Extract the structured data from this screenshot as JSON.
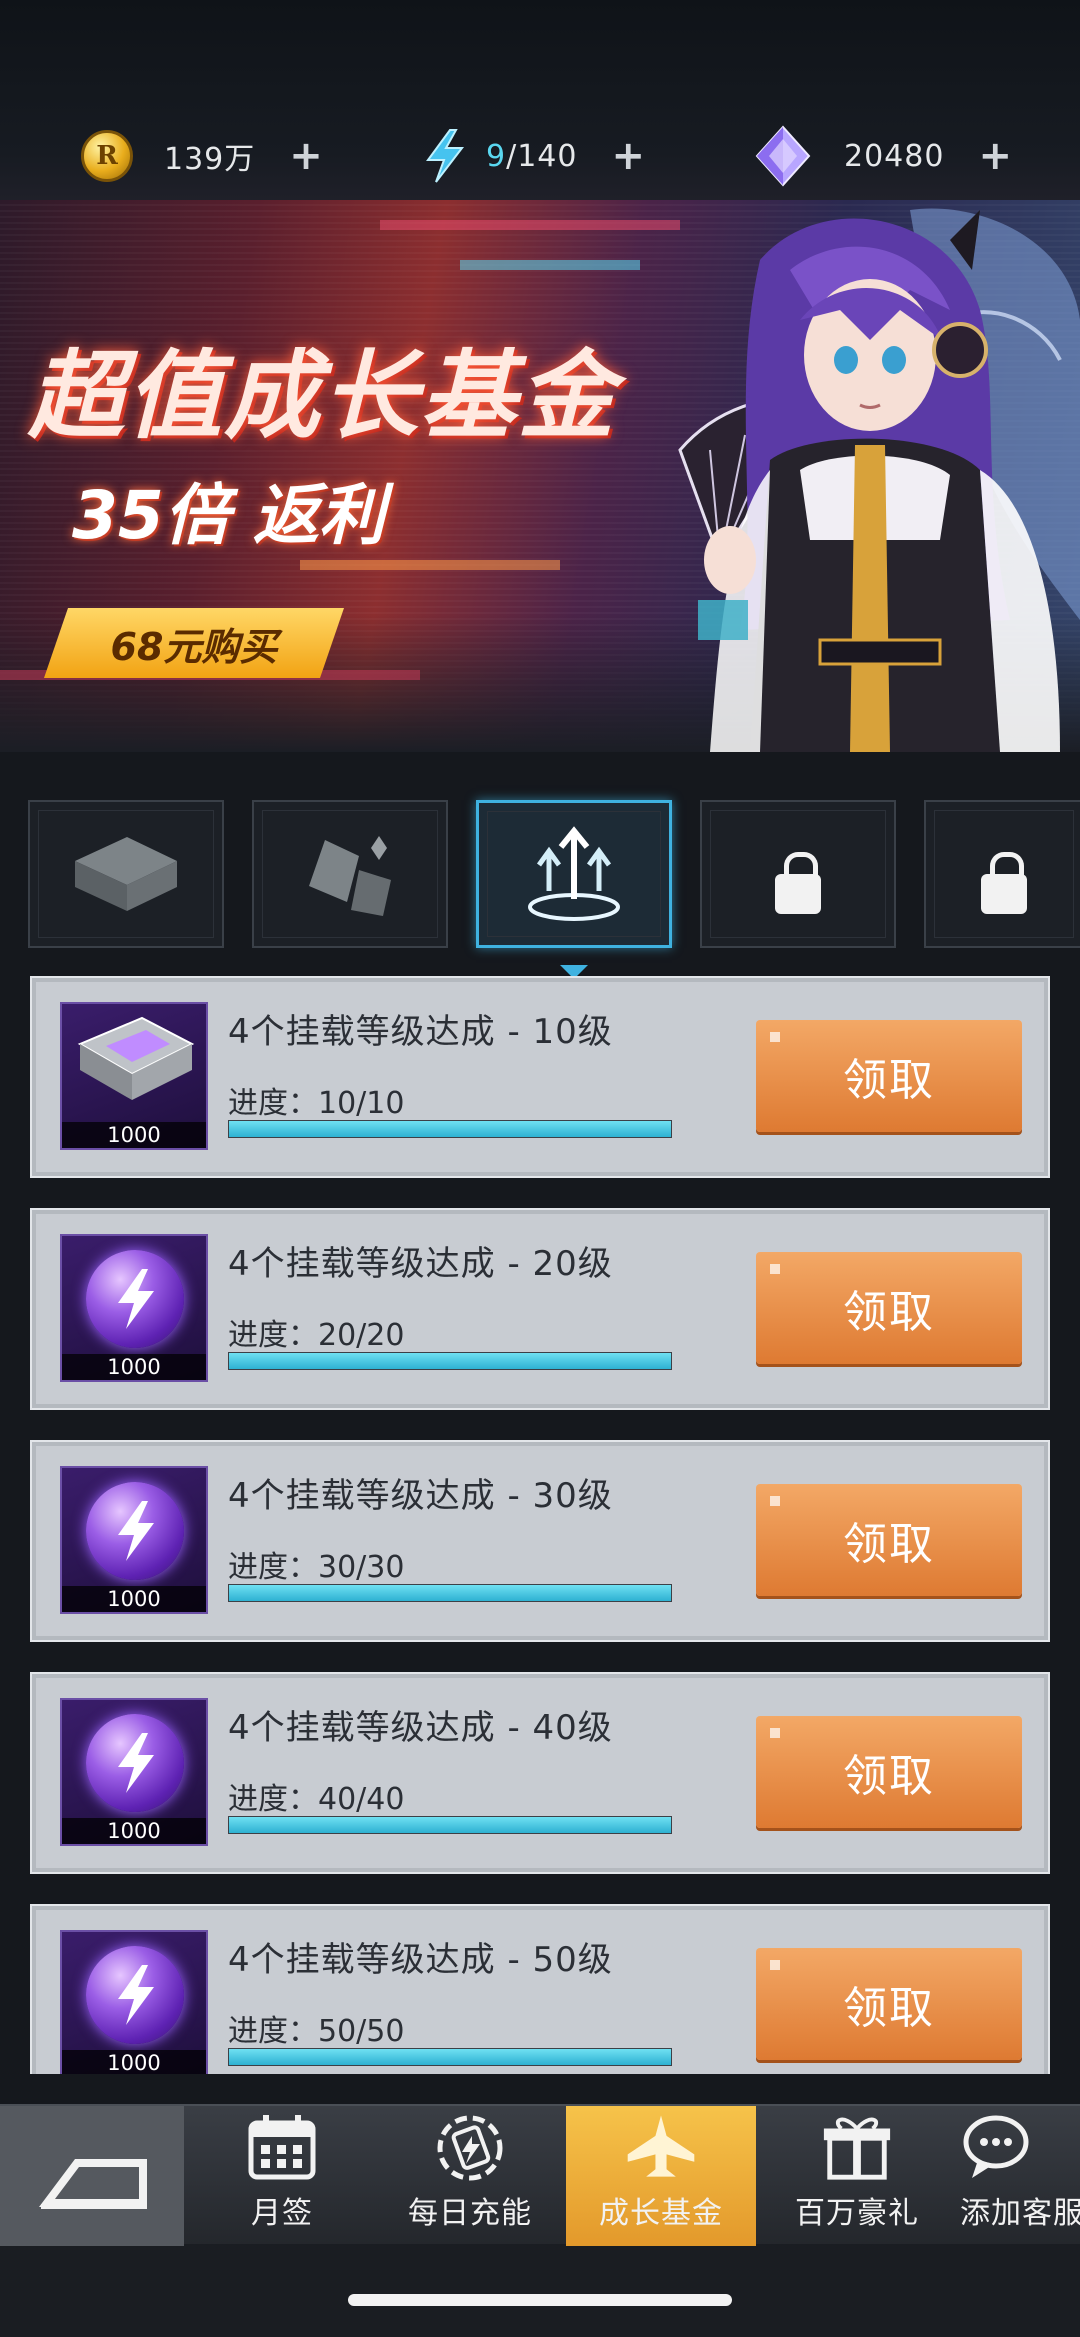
{
  "resources": {
    "coins": {
      "icon": "r-coin-icon",
      "value": "139万"
    },
    "energy": {
      "icon": "lightning-icon",
      "current": "9",
      "max": "/140"
    },
    "crystals": {
      "icon": "crystal-icon",
      "value": "20480"
    },
    "plus": "+"
  },
  "banner": {
    "title": "超值成长基金",
    "subtitle": "35倍 返利",
    "buy_label": "68元购买"
  },
  "tasks": [
    {
      "name": "4个挂载等级达成 - 10级",
      "progress_label": "进度：",
      "progress": "10/10",
      "fraction": 1.0,
      "reward_qty": "1000",
      "reward_icon": "chip-icon",
      "claim_label": "领取"
    },
    {
      "name": "4个挂载等级达成 - 20级",
      "progress_label": "进度：",
      "progress": "20/20",
      "fraction": 1.0,
      "reward_qty": "1000",
      "reward_icon": "energy-orb-icon",
      "claim_label": "领取"
    },
    {
      "name": "4个挂载等级达成 - 30级",
      "progress_label": "进度：",
      "progress": "30/30",
      "fraction": 1.0,
      "reward_qty": "1000",
      "reward_icon": "energy-orb-icon",
      "claim_label": "领取"
    },
    {
      "name": "4个挂载等级达成 - 40级",
      "progress_label": "进度：",
      "progress": "40/40",
      "fraction": 1.0,
      "reward_qty": "1000",
      "reward_icon": "energy-orb-icon",
      "claim_label": "领取"
    },
    {
      "name": "4个挂载等级达成 - 50级",
      "progress_label": "进度：",
      "progress": "50/50",
      "fraction": 1.0,
      "reward_qty": "1000",
      "reward_icon": "energy-orb-icon",
      "claim_label": "领取"
    }
  ],
  "nav": {
    "monthly": "月签",
    "daily": "每日充能",
    "growth": "成长基金",
    "gift": "百万豪礼",
    "service": "添加客服"
  },
  "colors": {
    "accent": "#3fb2e0",
    "claim": "#e8873f",
    "nav_active": "#f0b33c",
    "card": "#c8ccd2"
  }
}
